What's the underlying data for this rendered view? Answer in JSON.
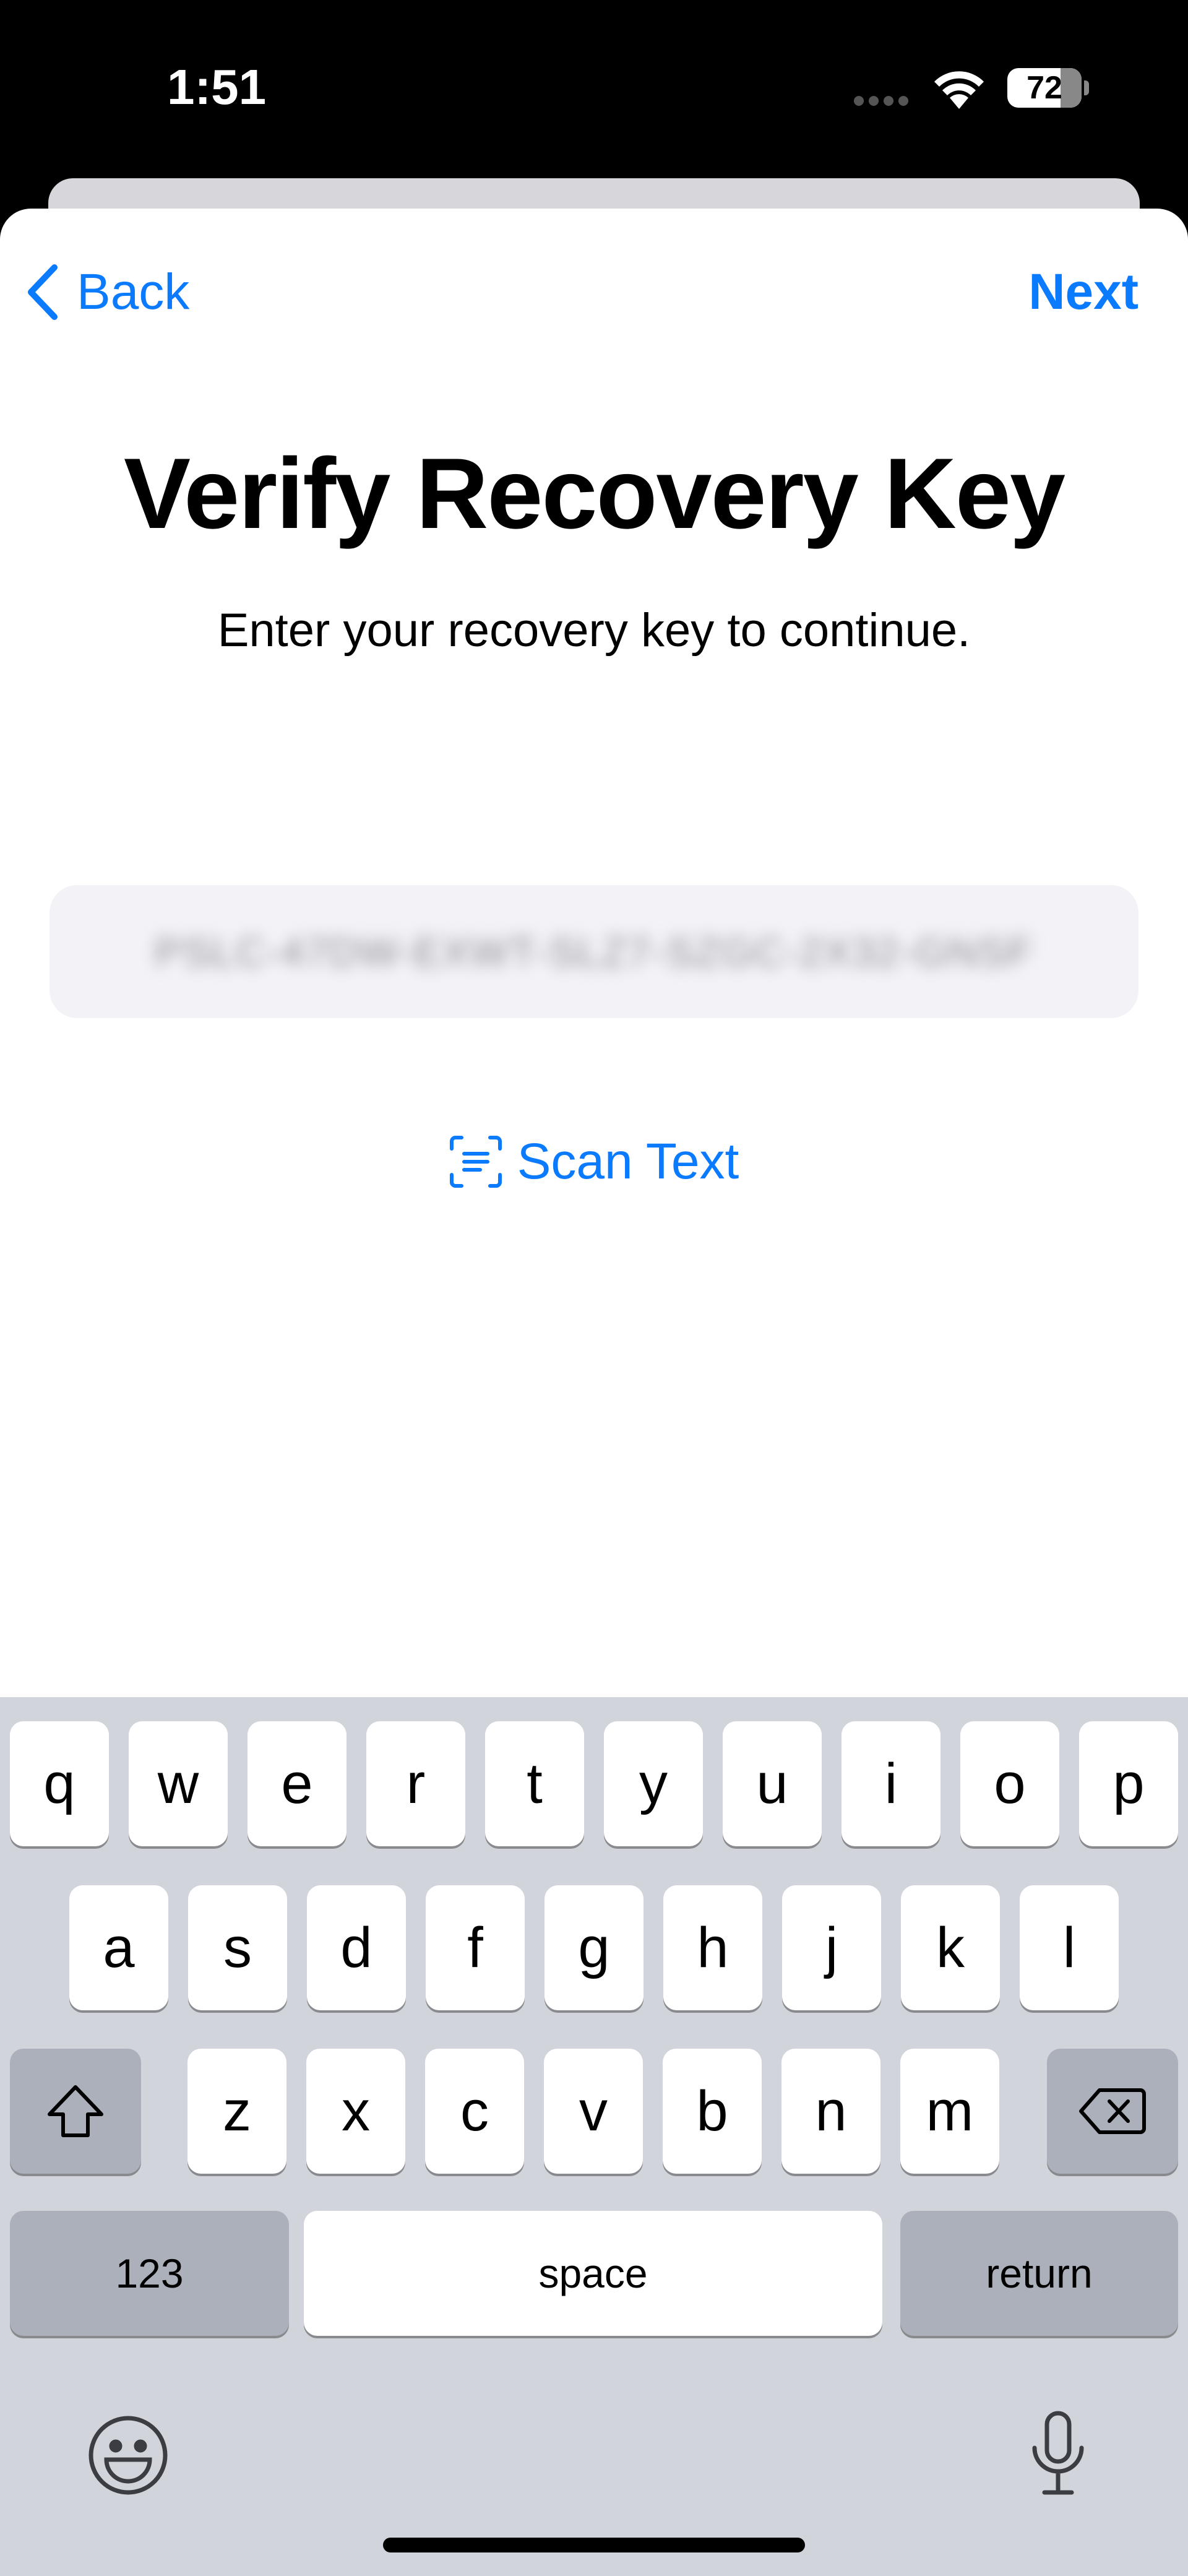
{
  "status_bar": {
    "time": "1:51",
    "battery": "72",
    "battery_level": 72
  },
  "nav": {
    "back_label": "Back",
    "next_label": "Next"
  },
  "content": {
    "title": "Verify Recovery Key",
    "subtitle": "Enter your recovery key to continue.",
    "recovery_key_value": "PSLC-47DW-EXWT-SLZ7-SZGC-2X32-GNSF",
    "scan_text_label": "Scan Text"
  },
  "keyboard": {
    "row1": [
      "q",
      "w",
      "e",
      "r",
      "t",
      "y",
      "u",
      "i",
      "o",
      "p"
    ],
    "row2": [
      "a",
      "s",
      "d",
      "f",
      "g",
      "h",
      "j",
      "k",
      "l"
    ],
    "row3": [
      "z",
      "x",
      "c",
      "v",
      "b",
      "n",
      "m"
    ],
    "numbers_label": "123",
    "space_label": "space",
    "return_label": "return"
  },
  "colors": {
    "accent": "#0a7aff",
    "keyboard_bg": "#d1d4db",
    "field_bg": "#f2f2f7"
  }
}
